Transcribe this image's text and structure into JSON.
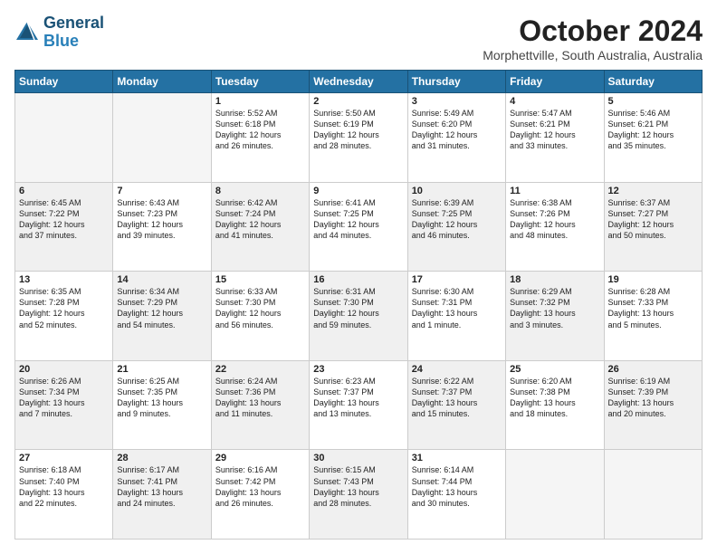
{
  "header": {
    "logo_line1": "General",
    "logo_line2": "Blue",
    "month": "October 2024",
    "location": "Morphettville, South Australia, Australia"
  },
  "days_of_week": [
    "Sunday",
    "Monday",
    "Tuesday",
    "Wednesday",
    "Thursday",
    "Friday",
    "Saturday"
  ],
  "weeks": [
    [
      {
        "day": "",
        "info": "",
        "empty": true
      },
      {
        "day": "",
        "info": "",
        "empty": true
      },
      {
        "day": "1",
        "info": "Sunrise: 5:52 AM\nSunset: 6:18 PM\nDaylight: 12 hours\nand 26 minutes."
      },
      {
        "day": "2",
        "info": "Sunrise: 5:50 AM\nSunset: 6:19 PM\nDaylight: 12 hours\nand 28 minutes."
      },
      {
        "day": "3",
        "info": "Sunrise: 5:49 AM\nSunset: 6:20 PM\nDaylight: 12 hours\nand 31 minutes."
      },
      {
        "day": "4",
        "info": "Sunrise: 5:47 AM\nSunset: 6:21 PM\nDaylight: 12 hours\nand 33 minutes."
      },
      {
        "day": "5",
        "info": "Sunrise: 5:46 AM\nSunset: 6:21 PM\nDaylight: 12 hours\nand 35 minutes."
      }
    ],
    [
      {
        "day": "6",
        "info": "Sunrise: 6:45 AM\nSunset: 7:22 PM\nDaylight: 12 hours\nand 37 minutes.",
        "shaded": true
      },
      {
        "day": "7",
        "info": "Sunrise: 6:43 AM\nSunset: 7:23 PM\nDaylight: 12 hours\nand 39 minutes."
      },
      {
        "day": "8",
        "info": "Sunrise: 6:42 AM\nSunset: 7:24 PM\nDaylight: 12 hours\nand 41 minutes.",
        "shaded": true
      },
      {
        "day": "9",
        "info": "Sunrise: 6:41 AM\nSunset: 7:25 PM\nDaylight: 12 hours\nand 44 minutes."
      },
      {
        "day": "10",
        "info": "Sunrise: 6:39 AM\nSunset: 7:25 PM\nDaylight: 12 hours\nand 46 minutes.",
        "shaded": true
      },
      {
        "day": "11",
        "info": "Sunrise: 6:38 AM\nSunset: 7:26 PM\nDaylight: 12 hours\nand 48 minutes."
      },
      {
        "day": "12",
        "info": "Sunrise: 6:37 AM\nSunset: 7:27 PM\nDaylight: 12 hours\nand 50 minutes.",
        "shaded": true
      }
    ],
    [
      {
        "day": "13",
        "info": "Sunrise: 6:35 AM\nSunset: 7:28 PM\nDaylight: 12 hours\nand 52 minutes."
      },
      {
        "day": "14",
        "info": "Sunrise: 6:34 AM\nSunset: 7:29 PM\nDaylight: 12 hours\nand 54 minutes.",
        "shaded": true
      },
      {
        "day": "15",
        "info": "Sunrise: 6:33 AM\nSunset: 7:30 PM\nDaylight: 12 hours\nand 56 minutes."
      },
      {
        "day": "16",
        "info": "Sunrise: 6:31 AM\nSunset: 7:30 PM\nDaylight: 12 hours\nand 59 minutes.",
        "shaded": true
      },
      {
        "day": "17",
        "info": "Sunrise: 6:30 AM\nSunset: 7:31 PM\nDaylight: 13 hours\nand 1 minute."
      },
      {
        "day": "18",
        "info": "Sunrise: 6:29 AM\nSunset: 7:32 PM\nDaylight: 13 hours\nand 3 minutes.",
        "shaded": true
      },
      {
        "day": "19",
        "info": "Sunrise: 6:28 AM\nSunset: 7:33 PM\nDaylight: 13 hours\nand 5 minutes."
      }
    ],
    [
      {
        "day": "20",
        "info": "Sunrise: 6:26 AM\nSunset: 7:34 PM\nDaylight: 13 hours\nand 7 minutes.",
        "shaded": true
      },
      {
        "day": "21",
        "info": "Sunrise: 6:25 AM\nSunset: 7:35 PM\nDaylight: 13 hours\nand 9 minutes."
      },
      {
        "day": "22",
        "info": "Sunrise: 6:24 AM\nSunset: 7:36 PM\nDaylight: 13 hours\nand 11 minutes.",
        "shaded": true
      },
      {
        "day": "23",
        "info": "Sunrise: 6:23 AM\nSunset: 7:37 PM\nDaylight: 13 hours\nand 13 minutes."
      },
      {
        "day": "24",
        "info": "Sunrise: 6:22 AM\nSunset: 7:37 PM\nDaylight: 13 hours\nand 15 minutes.",
        "shaded": true
      },
      {
        "day": "25",
        "info": "Sunrise: 6:20 AM\nSunset: 7:38 PM\nDaylight: 13 hours\nand 18 minutes."
      },
      {
        "day": "26",
        "info": "Sunrise: 6:19 AM\nSunset: 7:39 PM\nDaylight: 13 hours\nand 20 minutes.",
        "shaded": true
      }
    ],
    [
      {
        "day": "27",
        "info": "Sunrise: 6:18 AM\nSunset: 7:40 PM\nDaylight: 13 hours\nand 22 minutes."
      },
      {
        "day": "28",
        "info": "Sunrise: 6:17 AM\nSunset: 7:41 PM\nDaylight: 13 hours\nand 24 minutes.",
        "shaded": true
      },
      {
        "day": "29",
        "info": "Sunrise: 6:16 AM\nSunset: 7:42 PM\nDaylight: 13 hours\nand 26 minutes."
      },
      {
        "day": "30",
        "info": "Sunrise: 6:15 AM\nSunset: 7:43 PM\nDaylight: 13 hours\nand 28 minutes.",
        "shaded": true
      },
      {
        "day": "31",
        "info": "Sunrise: 6:14 AM\nSunset: 7:44 PM\nDaylight: 13 hours\nand 30 minutes."
      },
      {
        "day": "",
        "info": "",
        "empty": true
      },
      {
        "day": "",
        "info": "",
        "empty": true
      }
    ]
  ]
}
